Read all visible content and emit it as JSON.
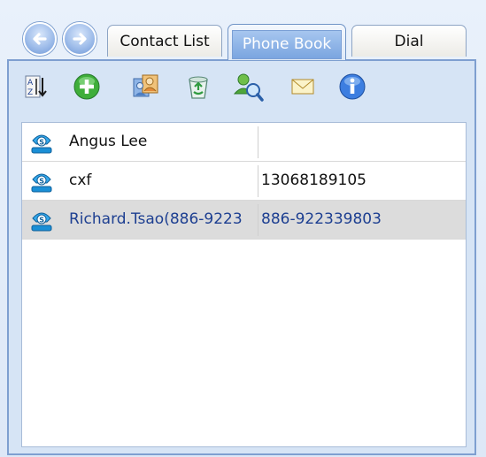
{
  "navigation": {
    "back_icon": "back-arrow-icon",
    "forward_icon": "forward-arrow-icon"
  },
  "tabs": [
    {
      "label": "Contact List",
      "active": false
    },
    {
      "label": "Phone Book",
      "active": true
    },
    {
      "label": "Dial",
      "active": false
    }
  ],
  "toolbar": [
    {
      "icon": "sort-az-icon"
    },
    {
      "icon": "add-icon"
    },
    {
      "icon": "import-contacts-icon"
    },
    {
      "icon": "recycle-bin-icon"
    },
    {
      "icon": "search-contact-icon"
    },
    {
      "icon": "mail-icon"
    },
    {
      "icon": "info-icon"
    }
  ],
  "contacts": [
    {
      "name": "Angus Lee",
      "number": "",
      "selected": false
    },
    {
      "name": "cxf",
      "number": "13068189105",
      "selected": false
    },
    {
      "name": "Richard.Tsao(886-9223",
      "number": "886-922339803",
      "selected": true
    }
  ],
  "colors": {
    "accent": "#7ba5e0",
    "selection": "#dcdcdc",
    "selected_text": "#1d3f91"
  }
}
